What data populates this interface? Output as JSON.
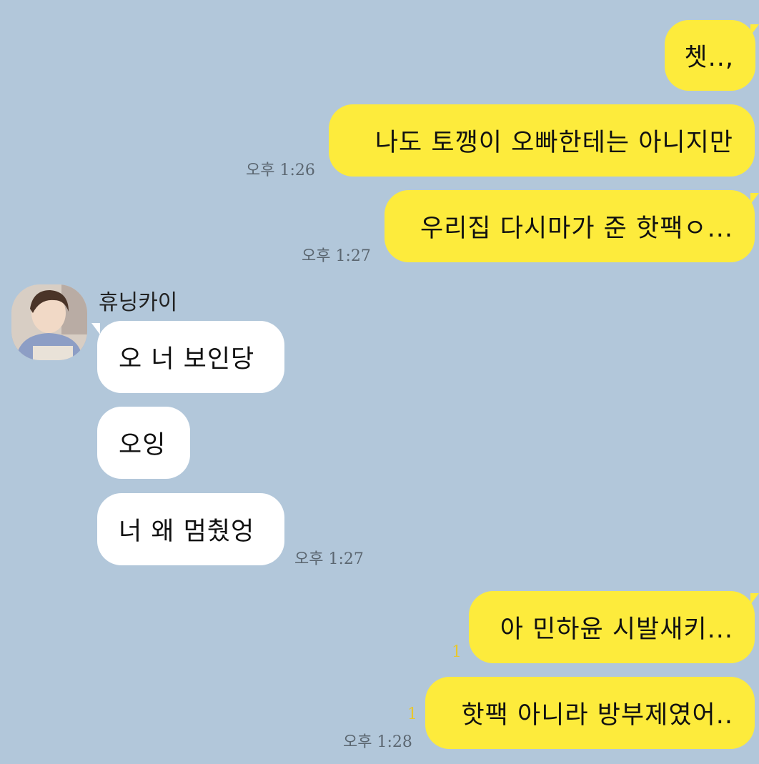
{
  "colors": {
    "background": "#b2c7da",
    "my_bubble": "#fdeb3c",
    "their_bubble": "#ffffff",
    "unread": "#e8c72d"
  },
  "contact": {
    "name": "휴닝카이"
  },
  "messages": [
    {
      "text": "쳇..,",
      "sender": "me"
    },
    {
      "text": "나도 토깽이 오빠한테는 아니지만",
      "sender": "me",
      "time": "오후 1:26"
    },
    {
      "text": "우리집 다시마가 준 핫팩ㅇ...",
      "sender": "me",
      "time": "오후 1:27"
    },
    {
      "text": "오 너 보인당",
      "sender": "them"
    },
    {
      "text": "오잉",
      "sender": "them"
    },
    {
      "text": "너 왜 멈췄엉",
      "sender": "them",
      "time": "오후 1:27"
    },
    {
      "text": "아 민하윤 시발새키...",
      "sender": "me",
      "unread": "1"
    },
    {
      "text": "핫팩 아니라 방부제였어..",
      "sender": "me",
      "unread": "1",
      "time": "오후 1:28"
    }
  ]
}
